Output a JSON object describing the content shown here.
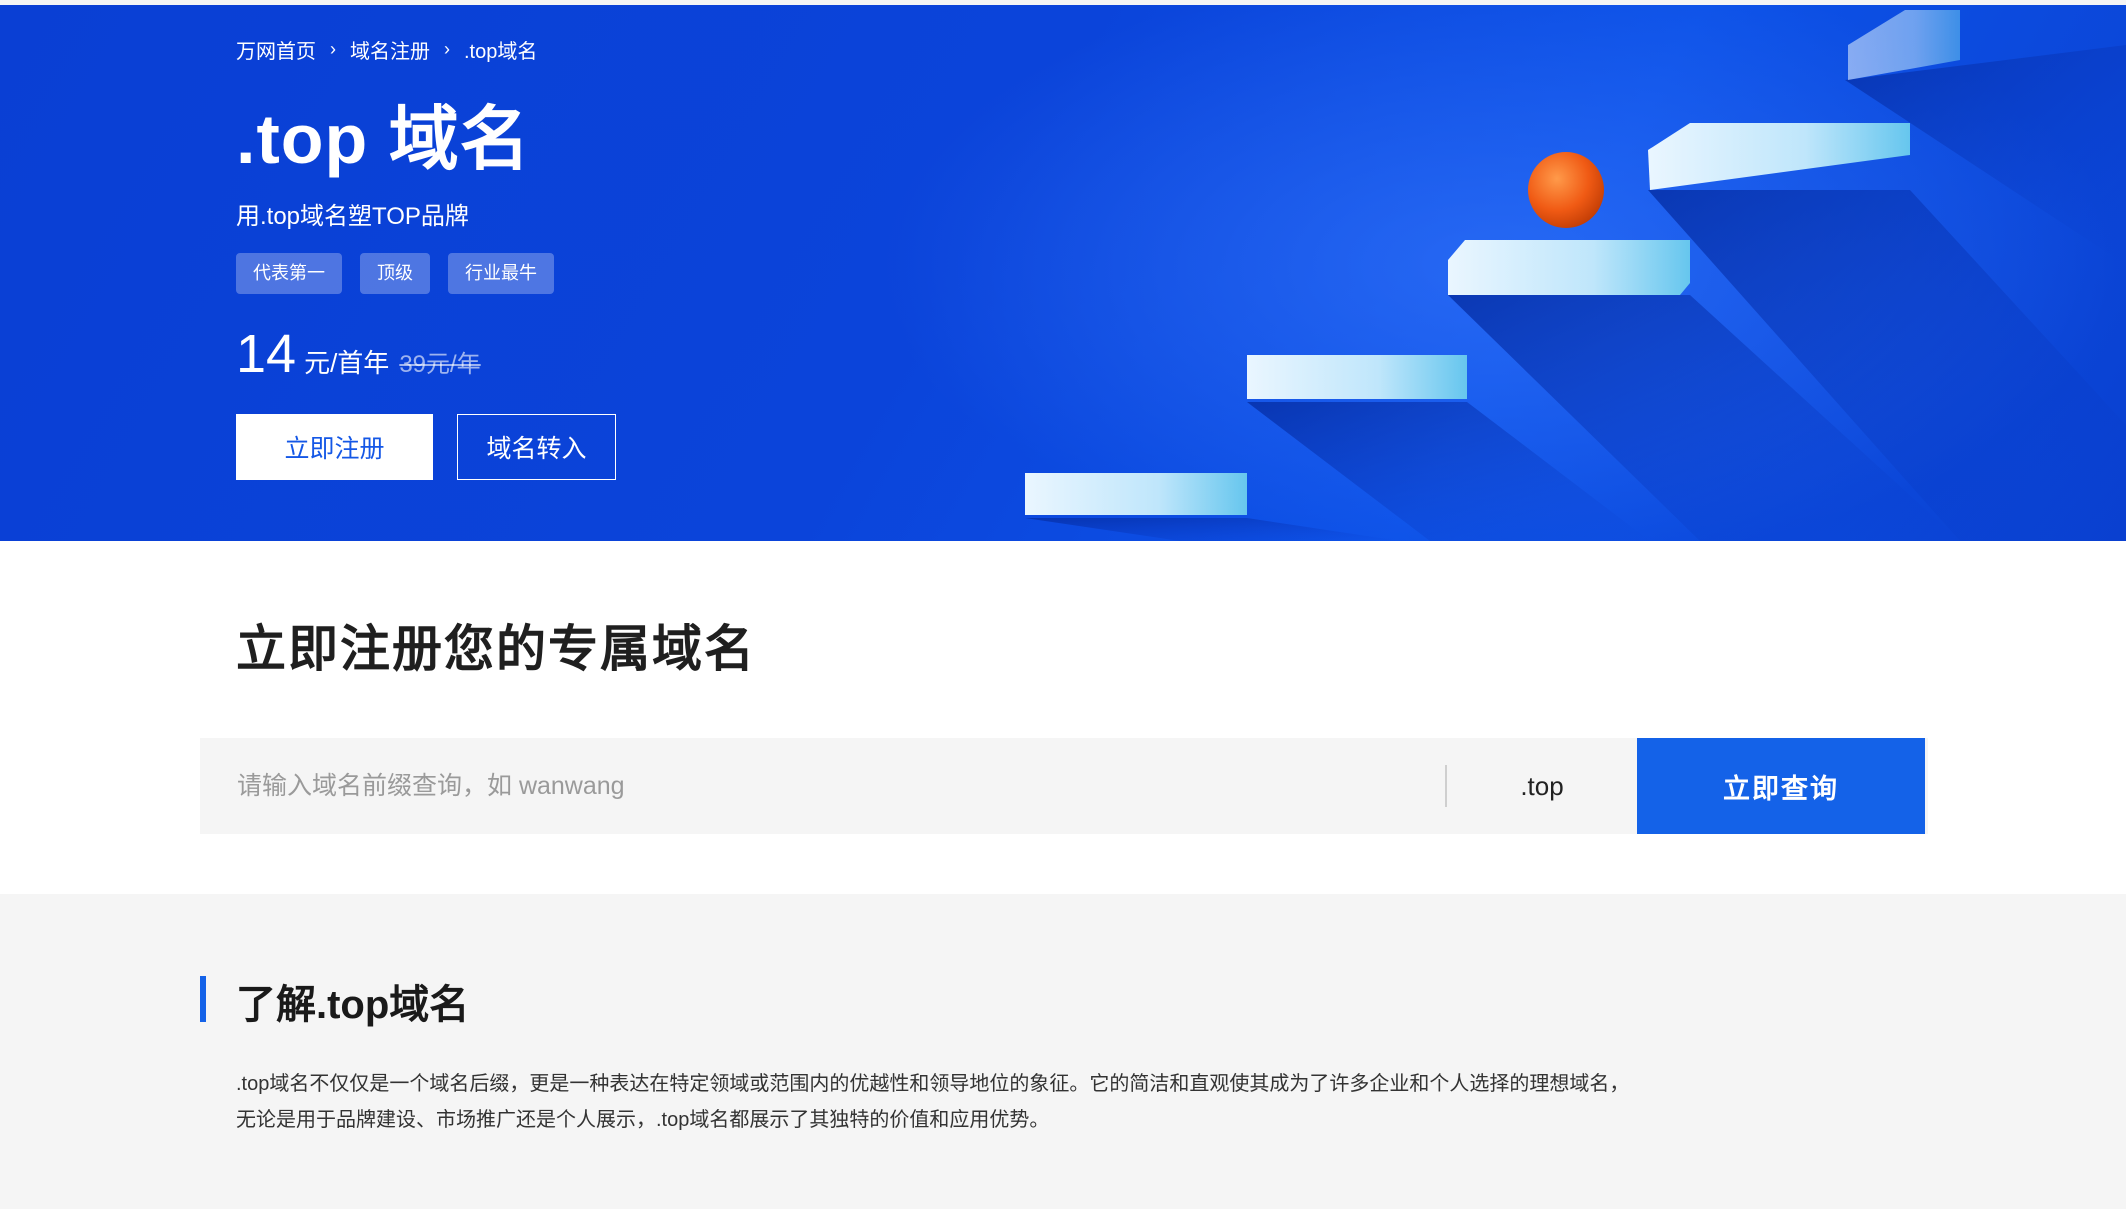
{
  "breadcrumb": {
    "home": "万网首页",
    "level2": "域名注册",
    "current": ".top域名",
    "separator": "›"
  },
  "hero": {
    "title": ".top 域名",
    "subtitle": "用.top域名塑TOP品牌",
    "tags": [
      "代表第一",
      "顶级",
      "行业最牛"
    ],
    "price": {
      "value": "14",
      "unit": "元/首年",
      "original": "39元/年"
    },
    "register_button": "立即注册",
    "transfer_button": "域名转入"
  },
  "registration": {
    "title": "立即注册您的专属域名",
    "search_placeholder": "请输入域名前缀查询，如 wanwang",
    "suffix": ".top",
    "search_button": "立即查询"
  },
  "about": {
    "title": "了解.top域名",
    "description_line1": ".top域名不仅仅是一个域名后缀，更是一种表达在特定领域或范围内的优越性和领导地位的象征。它的简洁和直观使其成为了许多企业和个人选择的理想域名，",
    "description_line2": "无论是用于品牌建设、市场推广还是个人展示，.top域名都展示了其独特的价值和应用优势。"
  },
  "colors": {
    "brand_blue": "#1462e8",
    "hero_bg": "#0b44da",
    "orange_ball": "#f05a14"
  }
}
